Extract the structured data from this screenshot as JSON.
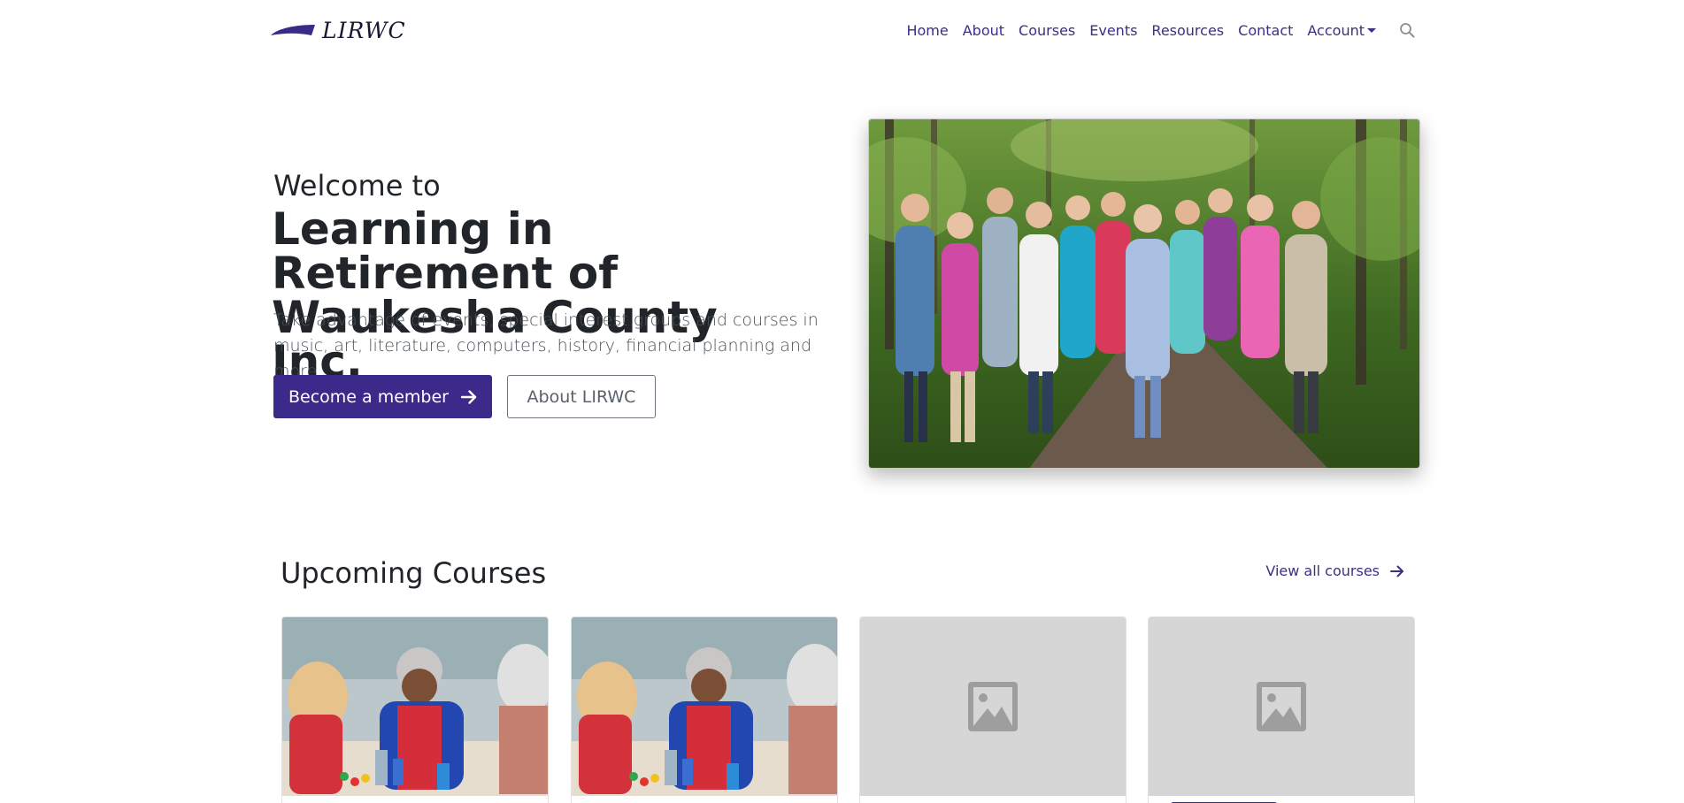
{
  "brand": {
    "name": "LIRWC",
    "accent": "#3b2a8a"
  },
  "nav": {
    "items": [
      {
        "label": "Home"
      },
      {
        "label": "About"
      },
      {
        "label": "Courses"
      },
      {
        "label": "Events"
      },
      {
        "label": "Resources"
      },
      {
        "label": "Contact"
      },
      {
        "label": "Account"
      }
    ],
    "search_icon": "search-icon",
    "link_color": "#3b2f86"
  },
  "hero": {
    "welcome": "Welcome to",
    "title": "Learning in Retirement of Waukesha County Inc.",
    "lead": "Take advantage of events, special interest groups and courses in music, art, literature, computers, history, financial planning and more.",
    "primary_button": "Become a member",
    "secondary_button": "About LIRWC",
    "photo_icon": "group-hike-photo"
  },
  "courses": {
    "heading": "Upcoming Courses",
    "view_all": "View all courses",
    "cards": [
      {
        "image": "painting-class-photo"
      },
      {
        "image": "painting-class-photo"
      },
      {
        "image": "image-placeholder-icon"
      },
      {
        "image": "image-placeholder-icon"
      }
    ]
  }
}
